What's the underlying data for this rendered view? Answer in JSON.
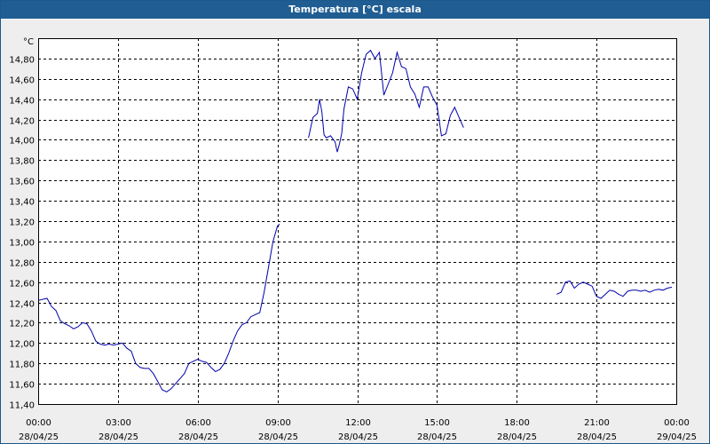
{
  "window": {
    "title": "Temperatura [°C] escala"
  },
  "colors": {
    "titlebar": "#1f5d92",
    "series": "#0000aa",
    "plot_bg": "#ffffff",
    "grid": "#000000"
  },
  "chart_data": {
    "type": "line",
    "title": "Temperatura [°C] escala",
    "ylabel": "°C",
    "xlabel": "",
    "xlim": [
      "28/04/25 00:00",
      "29/04/25 00:00"
    ],
    "ylim": [
      11.4,
      15.0
    ],
    "grid": true,
    "grid_style": "dashed",
    "x_ticks": [
      {
        "time": "00:00",
        "date": "28/04/25"
      },
      {
        "time": "03:00",
        "date": "28/04/25"
      },
      {
        "time": "06:00",
        "date": "28/04/25"
      },
      {
        "time": "09:00",
        "date": "28/04/25"
      },
      {
        "time": "12:00",
        "date": "28/04/25"
      },
      {
        "time": "15:00",
        "date": "28/04/25"
      },
      {
        "time": "18:00",
        "date": "28/04/25"
      },
      {
        "time": "21:00",
        "date": "28/04/25"
      },
      {
        "time": "00:00",
        "date": "29/04/25"
      }
    ],
    "y_ticks": [
      "11,40",
      "11,60",
      "11,80",
      "12,00",
      "12,20",
      "12,40",
      "12,60",
      "12,80",
      "13,00",
      "13,20",
      "13,40",
      "13,60",
      "13,80",
      "14,00",
      "14,20",
      "14,40",
      "14,60",
      "14,80"
    ],
    "series": [
      {
        "color": "#0000aa",
        "segments": [
          [
            [
              "00:00",
              12.42
            ],
            [
              "00:20",
              12.44
            ],
            [
              "00:30",
              12.36
            ],
            [
              "00:40",
              12.32
            ],
            [
              "00:50",
              12.22
            ],
            [
              "01:00",
              12.19
            ],
            [
              "01:10",
              12.17
            ],
            [
              "01:20",
              12.14
            ],
            [
              "01:30",
              12.16
            ],
            [
              "01:40",
              12.2
            ],
            [
              "01:50",
              12.19
            ],
            [
              "02:00",
              12.12
            ],
            [
              "02:10",
              12.02
            ],
            [
              "02:20",
              11.99
            ],
            [
              "02:30",
              11.98
            ],
            [
              "02:40",
              11.99
            ],
            [
              "02:50",
              11.98
            ],
            [
              "03:00",
              11.99
            ],
            [
              "03:10",
              12.0
            ],
            [
              "03:20",
              11.95
            ],
            [
              "03:30",
              11.92
            ],
            [
              "03:40",
              11.8
            ],
            [
              "03:50",
              11.76
            ],
            [
              "04:00",
              11.75
            ],
            [
              "04:10",
              11.75
            ],
            [
              "04:20",
              11.7
            ],
            [
              "04:30",
              11.62
            ],
            [
              "04:40",
              11.54
            ],
            [
              "04:50",
              11.52
            ],
            [
              "05:00",
              11.55
            ],
            [
              "05:10",
              11.6
            ],
            [
              "05:20",
              11.65
            ],
            [
              "05:30",
              11.7
            ],
            [
              "05:40",
              11.8
            ],
            [
              "05:50",
              11.82
            ],
            [
              "06:00",
              11.84
            ],
            [
              "06:10",
              11.82
            ],
            [
              "06:20",
              11.81
            ],
            [
              "06:30",
              11.76
            ],
            [
              "06:40",
              11.72
            ],
            [
              "06:50",
              11.74
            ],
            [
              "07:00",
              11.8
            ],
            [
              "07:10",
              11.9
            ],
            [
              "07:20",
              12.02
            ],
            [
              "07:30",
              12.12
            ],
            [
              "07:40",
              12.18
            ],
            [
              "07:50",
              12.2
            ],
            [
              "08:00",
              12.26
            ],
            [
              "08:10",
              12.28
            ],
            [
              "08:20",
              12.3
            ],
            [
              "08:30",
              12.5
            ],
            [
              "08:40",
              12.75
            ],
            [
              "08:50",
              13.0
            ],
            [
              "09:00",
              13.15
            ],
            [
              "09:05",
              13.17
            ]
          ],
          [
            [
              "10:10",
              14.02
            ],
            [
              "10:20",
              14.22
            ],
            [
              "10:30",
              14.26
            ],
            [
              "10:35",
              14.4
            ],
            [
              "10:40",
              14.28
            ],
            [
              "10:45",
              14.05
            ],
            [
              "10:50",
              14.02
            ],
            [
              "11:00",
              14.04
            ],
            [
              "11:10",
              13.98
            ],
            [
              "11:15",
              13.88
            ],
            [
              "11:20",
              13.96
            ],
            [
              "11:25",
              14.06
            ],
            [
              "11:30",
              14.3
            ],
            [
              "11:40",
              14.52
            ],
            [
              "11:50",
              14.5
            ],
            [
              "12:00",
              14.4
            ],
            [
              "12:10",
              14.66
            ],
            [
              "12:20",
              14.84
            ],
            [
              "12:30",
              14.88
            ],
            [
              "12:40",
              14.8
            ],
            [
              "12:50",
              14.86
            ],
            [
              "13:00",
              14.44
            ],
            [
              "13:10",
              14.55
            ],
            [
              "13:20",
              14.66
            ],
            [
              "13:30",
              14.86
            ],
            [
              "13:40",
              14.72
            ],
            [
              "13:50",
              14.7
            ],
            [
              "14:00",
              14.52
            ],
            [
              "14:10",
              14.45
            ],
            [
              "14:20",
              14.32
            ],
            [
              "14:30",
              14.52
            ],
            [
              "14:40",
              14.52
            ],
            [
              "14:50",
              14.42
            ],
            [
              "15:00",
              14.34
            ],
            [
              "15:10",
              14.04
            ],
            [
              "15:20",
              14.06
            ],
            [
              "15:30",
              14.24
            ],
            [
              "15:40",
              14.32
            ],
            [
              "15:50",
              14.22
            ],
            [
              "16:00",
              14.12
            ]
          ],
          [
            [
              "19:30",
              12.48
            ],
            [
              "19:40",
              12.5
            ],
            [
              "19:50",
              12.6
            ],
            [
              "20:00",
              12.61
            ],
            [
              "20:10",
              12.54
            ],
            [
              "20:20",
              12.58
            ],
            [
              "20:30",
              12.6
            ],
            [
              "20:40",
              12.58
            ],
            [
              "20:50",
              12.56
            ],
            [
              "21:00",
              12.46
            ],
            [
              "21:10",
              12.44
            ],
            [
              "21:20",
              12.48
            ],
            [
              "21:30",
              12.52
            ],
            [
              "21:40",
              12.51
            ],
            [
              "21:50",
              12.48
            ],
            [
              "22:00",
              12.46
            ],
            [
              "22:10",
              12.51
            ],
            [
              "22:20",
              12.52
            ],
            [
              "22:30",
              12.52
            ],
            [
              "22:40",
              12.51
            ],
            [
              "22:50",
              12.52
            ],
            [
              "23:00",
              12.5
            ],
            [
              "23:10",
              12.52
            ],
            [
              "23:20",
              12.53
            ],
            [
              "23:30",
              12.52
            ],
            [
              "23:40",
              12.54
            ],
            [
              "23:50",
              12.55
            ]
          ]
        ]
      }
    ]
  }
}
